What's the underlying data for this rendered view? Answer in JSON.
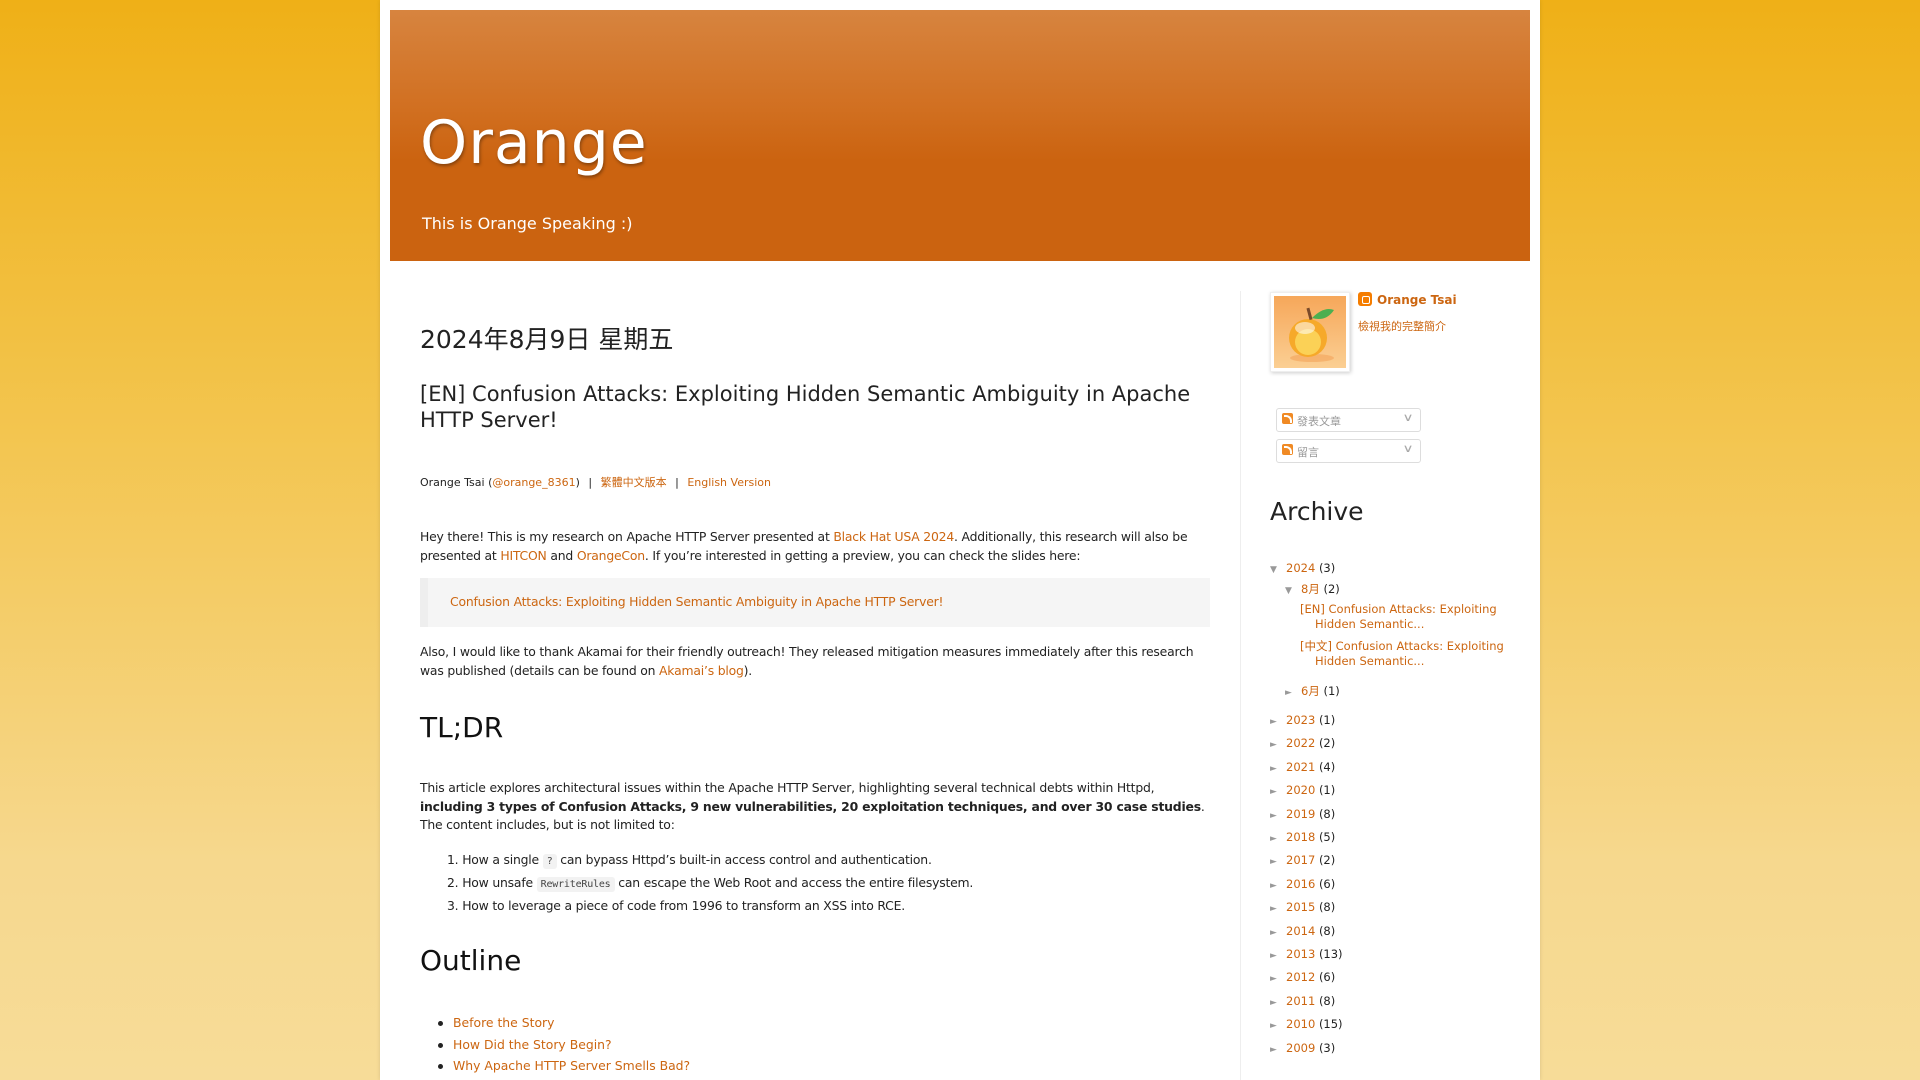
{
  "blog": {
    "title": "Orange",
    "tagline": "This is Orange Speaking :)"
  },
  "post": {
    "date_header": "2024年8月9日 星期五",
    "title": "[EN] Confusion Attacks: Exploiting Hidden Semantic Ambiguity in Apache HTTP Server!",
    "byline": {
      "author": "Orange Tsai (",
      "handle": "@orange_8361",
      "close": ")",
      "sep": "|",
      "zh_link": "繁體中文版本",
      "en_link": "English Version"
    },
    "p1": {
      "t1": "Hey there! This is my research on Apache HTTP Server presented at ",
      "link1": "Black Hat USA 2024",
      "t2": ". Additionally, this research will also be presented at ",
      "link2": "HITCON",
      "t3": " and ",
      "link3": "OrangeCon",
      "t4": ". If you’re interested in getting a preview, you can check the slides here:"
    },
    "quote_link": "Confusion Attacks: Exploiting Hidden Semantic Ambiguity in Apache HTTP Server!",
    "p2": {
      "t1": "Also, I would like to thank Akamai for their friendly outreach! They released mitigation measures immediately after this research was published (details can be found on ",
      "link": "Akamai’s blog",
      "t2": ")."
    },
    "tldr_heading": "TL;DR",
    "p3": {
      "t1": "This article explores architectural issues within the Apache HTTP Server, highlighting several technical debts within Httpd, ",
      "bold": "including 3 types of Confusion Attacks, 9 new vulnerabilities, 20 exploitation techniques, and over 30 case studies",
      "t2": ". The content includes, but is not limited to:"
    },
    "list": [
      {
        "num": "1.",
        "pre": "How a single ",
        "code": "?",
        "post": " can bypass Httpd’s built-in access control and authentication."
      },
      {
        "num": "2.",
        "pre": "How unsafe ",
        "code": "RewriteRules",
        "post": " can escape the Web Root and access the entire filesystem."
      },
      {
        "num": "3.",
        "pre": "How to leverage a piece of code from 1996 to transform an XSS into RCE.",
        "code": null,
        "post": ""
      }
    ],
    "outline_heading": "Outline",
    "outline": [
      "Before the Story",
      "How Did the Story Begin?",
      "Why Apache HTTP Server Smells Bad?"
    ]
  },
  "sidebar": {
    "profile_name": "Orange Tsai",
    "profile_link": "檢視我的完整簡介",
    "feeds": [
      "發表文章",
      "留言"
    ],
    "archive_title": "Archive",
    "archive": {
      "current_year": {
        "label": "2024",
        "count": "(3)",
        "expanded": true,
        "months": [
          {
            "label": "8月",
            "count": "(2)",
            "expanded": true,
            "posts": [
              "[EN] Confusion Attacks: Exploiting Hidden Semantic...",
              "[中文] Confusion Attacks: Exploiting Hidden Semantic..."
            ]
          },
          {
            "label": "6月",
            "count": "(1)",
            "expanded": false
          }
        ]
      },
      "years": [
        {
          "label": "2023",
          "count": "(1)"
        },
        {
          "label": "2022",
          "count": "(2)"
        },
        {
          "label": "2021",
          "count": "(4)"
        },
        {
          "label": "2020",
          "count": "(1)"
        },
        {
          "label": "2019",
          "count": "(8)"
        },
        {
          "label": "2018",
          "count": "(5)"
        },
        {
          "label": "2017",
          "count": "(2)"
        },
        {
          "label": "2016",
          "count": "(6)"
        },
        {
          "label": "2015",
          "count": "(8)"
        },
        {
          "label": "2014",
          "count": "(8)"
        },
        {
          "label": "2013",
          "count": "(13)"
        },
        {
          "label": "2012",
          "count": "(6)"
        },
        {
          "label": "2011",
          "count": "(8)"
        },
        {
          "label": "2010",
          "count": "(15)"
        },
        {
          "label": "2009",
          "count": "(3)"
        }
      ]
    }
  },
  "colors": {
    "link": "#cc6611",
    "header": "#cb6310",
    "background": "#f2b41c"
  }
}
